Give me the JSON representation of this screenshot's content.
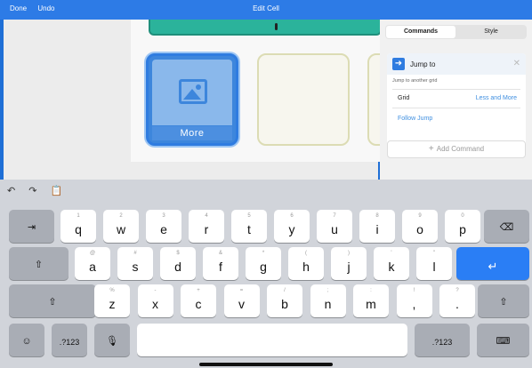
{
  "topbar": {
    "done": "Done",
    "undo": "Undo",
    "title": "Edit Cell"
  },
  "cell": {
    "selected_label": "More"
  },
  "panel": {
    "tabs": [
      "Commands",
      "Style"
    ],
    "command": {
      "title": "Jump to",
      "description": "Jump to another grid",
      "grid_key": "Grid",
      "grid_value": "Less and More",
      "follow": "Follow Jump"
    },
    "add_command": "Add Command"
  },
  "keyboard": {
    "row1": [
      {
        "hint": "1",
        "ch": "q"
      },
      {
        "hint": "2",
        "ch": "w"
      },
      {
        "hint": "3",
        "ch": "e"
      },
      {
        "hint": "4",
        "ch": "r"
      },
      {
        "hint": "5",
        "ch": "t"
      },
      {
        "hint": "6",
        "ch": "y"
      },
      {
        "hint": "7",
        "ch": "u"
      },
      {
        "hint": "8",
        "ch": "i"
      },
      {
        "hint": "9",
        "ch": "o"
      },
      {
        "hint": "0",
        "ch": "p"
      }
    ],
    "row2": [
      {
        "hint": "@",
        "ch": "a"
      },
      {
        "hint": "#",
        "ch": "s"
      },
      {
        "hint": "$",
        "ch": "d"
      },
      {
        "hint": "&",
        "ch": "f"
      },
      {
        "hint": "*",
        "ch": "g"
      },
      {
        "hint": "(",
        "ch": "h"
      },
      {
        "hint": ")",
        "ch": "j"
      },
      {
        "hint": "'",
        "ch": "k"
      },
      {
        "hint": "\"",
        "ch": "l"
      }
    ],
    "row3": [
      {
        "hint": "%",
        "ch": "z"
      },
      {
        "hint": "-",
        "ch": "x"
      },
      {
        "hint": "+",
        "ch": "c"
      },
      {
        "hint": "=",
        "ch": "v"
      },
      {
        "hint": "/",
        "ch": "b"
      },
      {
        "hint": ";",
        "ch": "n"
      },
      {
        "hint": ":",
        "ch": "m"
      },
      {
        "hint": "!",
        "ch": ","
      },
      {
        "hint": "?",
        "ch": "."
      }
    ],
    "tab": "⇥",
    "backspace": "⌫",
    "shift": "⇧",
    "return": "↵",
    "emoji": "☺",
    "num": ".?123",
    "mic": "🎙",
    "hide": "⌨",
    "tools": {
      "undo": "↶",
      "redo": "↷",
      "paste": "📋"
    }
  }
}
